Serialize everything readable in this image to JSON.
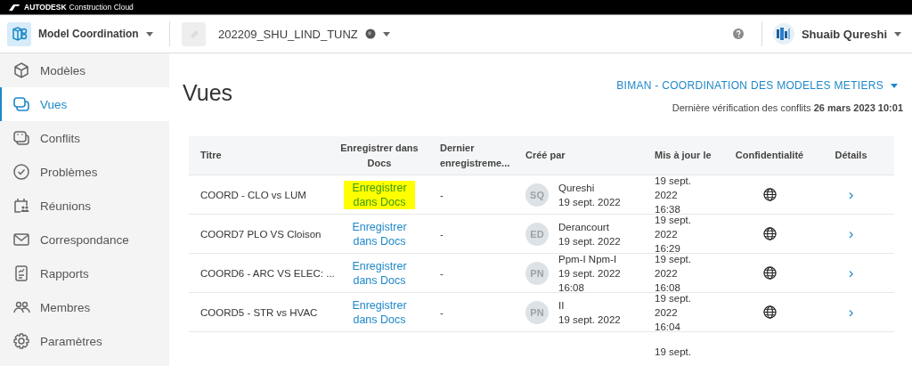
{
  "brand": {
    "logo": "AUTODESK",
    "product": "Construction Cloud"
  },
  "header": {
    "module": "Model Coordination",
    "project": "202209_SHU_LIND_TUNZ",
    "user": "Shuaib Qureshi"
  },
  "sidebar": {
    "items": [
      {
        "label": "Modèles",
        "selected": false
      },
      {
        "label": "Vues",
        "selected": true
      },
      {
        "label": "Conflits",
        "selected": false
      },
      {
        "label": "Problèmes",
        "selected": false
      },
      {
        "label": "Réunions",
        "selected": false
      },
      {
        "label": "Correspondance",
        "selected": false
      },
      {
        "label": "Rapports",
        "selected": false
      },
      {
        "label": "Membres",
        "selected": false
      },
      {
        "label": "Paramètres",
        "selected": false
      }
    ]
  },
  "page": {
    "title": "Vues",
    "model_set": "BIMAN - COORDINATION DES MODELES METIERS",
    "last_check": "Dernière vérification des conflits **26 mars 2023 10:01**"
  },
  "table": {
    "columns": [
      "Titre",
      "Enregistrer dans Docs",
      "Dernier enregistreme...",
      "Créé par",
      "Mis à jour le",
      "Confidentialité",
      "Détails"
    ],
    "rows": [
      {
        "title": "COORD - CLO vs LUM",
        "save": "Enregistrer dans Docs",
        "highlighted": true,
        "last": "-",
        "initials": "SQ",
        "created": [
          "Qureshi",
          "19 sept. 2022"
        ],
        "updated": [
          "19 sept.",
          "2022",
          "16:38"
        ],
        "public": true,
        "details": "›"
      },
      {
        "title": "COORD7 PLO VS Cloison",
        "save": "Enregistrer dans Docs",
        "highlighted": false,
        "last": "-",
        "initials": "ED",
        "created": [
          "Derancourt",
          "19 sept. 2022"
        ],
        "updated": [
          "19 sept.",
          "2022",
          "16:29"
        ],
        "public": true,
        "details": "›"
      },
      {
        "title": "COORD6 - ARC VS ELEC: ...",
        "save": "Enregistrer dans Docs",
        "highlighted": false,
        "last": "-",
        "initials": "PN",
        "created": [
          "Ppm-I Npm-I",
          "19 sept. 2022",
          "16:08"
        ],
        "updated": [
          "19 sept.",
          "2022",
          "16:08"
        ],
        "public": true,
        "details": "›"
      },
      {
        "title": "COORD5 - STR vs HVAC",
        "save": "Enregistrer dans Docs",
        "highlighted": false,
        "last": "-",
        "initials": "PN",
        "created": [
          "II",
          "19 sept. 2022"
        ],
        "updated": [
          "19 sept.",
          "2022",
          "16:04"
        ],
        "public": true,
        "details": "›"
      },
      {
        "updated": [
          "19 sept."
        ]
      }
    ]
  }
}
